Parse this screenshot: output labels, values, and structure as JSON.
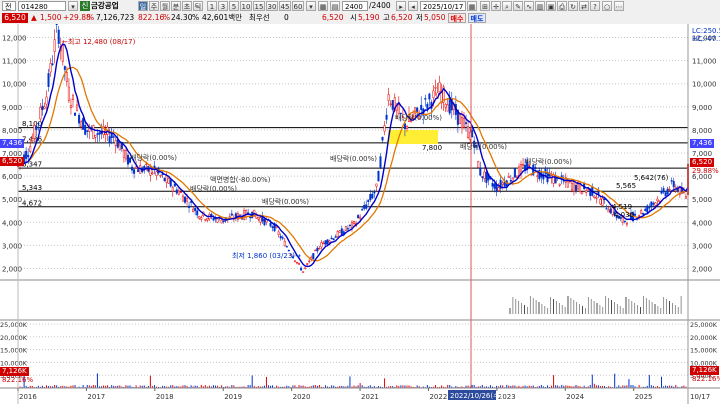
{
  "toolbar": {
    "code_prefix": "전",
    "code": "014280",
    "name": "금강공업",
    "period_buttons": [
      "주",
      "월",
      "분",
      "초",
      "틱"
    ],
    "interval_buttons": [
      "1",
      "3",
      "5",
      "10",
      "15",
      "30",
      "45",
      "60"
    ],
    "count": "2400",
    "count_total": "/2400",
    "date": "2025/10/17",
    "buy_label": "매수",
    "sell_label": "매도",
    "price_change_badge": "6,520",
    "change": "1,500",
    "change_pct": "+29.88",
    "volume": "7,126,723",
    "turnover_pct": "822.16",
    "ratio": "24.30",
    "amount": "42,601백만",
    "min_label": "최우선",
    "min_value": "0",
    "close": "6,520",
    "open_label": "시",
    "open": "5,190",
    "high_label": "고",
    "high": "6,520",
    "low_label": "저",
    "low": "5,050"
  },
  "price_axis": [
    "12,000",
    "11,000",
    "10,000",
    "9,000",
    "8,000",
    "7,000",
    "6,000",
    "5,000",
    "4,000",
    "3,000",
    "2,000"
  ],
  "volume_axis": [
    "25,000K",
    "20,000K",
    "15,000K",
    "10,000K",
    "5,000K"
  ],
  "year_labels": [
    "2016",
    "2017",
    "2018",
    "2019",
    "2020",
    "2021",
    "2022",
    "2023",
    "2024",
    "2025"
  ],
  "right_end_label": "10/17",
  "cursor_date": "2022/10/26(수)",
  "right_info": {
    "lc": "LC:250.54",
    "hc": "HC:-47.76"
  },
  "price_tags": {
    "left_red": "6,520",
    "left_top": "7,436",
    "right_top": "7,436",
    "right_red": "6,520",
    "right_pct": "29.88%",
    "right_vol_k": "7,126K",
    "right_vol_pct": "822.16%",
    "left_vol_k": "7,126K",
    "left_vol_pct": "822.16%"
  },
  "level_labels": [
    "8,100",
    "7,436",
    "6,347",
    "5,343",
    "4,672"
  ],
  "annotations": {
    "high": "최고 12,480 (08/17)",
    "low": "최저 1,860 (03/23)",
    "div1": "배당락(0.00%)",
    "div2": "배당락(0.00%)",
    "div3": "배당락(0.00%)",
    "div4": "배당락(0.00%)",
    "div5": "배당락(0.00%)",
    "div6": "배당락(0.00%)",
    "div7": "배당락(0.00%)",
    "reverse_split": "액면병합(-80.00%)",
    "p5642": "5,642(76)",
    "p7800": "7,800",
    "p5565": "5,565",
    "p4519": "4,519",
    "p4030": "4,030"
  },
  "colors": {
    "up": "#e60000",
    "down": "#0033cc",
    "ma_short": "#0000c8",
    "ma_long": "#e07800",
    "ma_mid": "#d00000",
    "grid": "#c8c8c8"
  },
  "chart_data": {
    "type": "candlestick",
    "x_range": [
      "2016-01",
      "2025-10-17"
    ],
    "ylim": [
      1500,
      12500
    ],
    "price_path": [
      [
        "2016-01",
        6400
      ],
      [
        "2016-03",
        7200
      ],
      [
        "2016-06",
        9500
      ],
      [
        "2016-08",
        12480
      ],
      [
        "2016-10",
        9500
      ],
      [
        "2017-01",
        8000
      ],
      [
        "2017-06",
        7700
      ],
      [
        "2017-09",
        6400
      ],
      [
        "2018-01",
        6200
      ],
      [
        "2018-05",
        5400
      ],
      [
        "2018-09",
        4300
      ],
      [
        "2019-01",
        4100
      ],
      [
        "2019-06",
        4400
      ],
      [
        "2019-10",
        3800
      ],
      [
        "2020-03",
        1860
      ],
      [
        "2020-06",
        3000
      ],
      [
        "2020-12",
        3900
      ],
      [
        "2021-04",
        5500
      ],
      [
        "2021-06",
        9500
      ],
      [
        "2021-09",
        8200
      ],
      [
        "2022-03",
        9700
      ],
      [
        "2022-09",
        7600
      ],
      [
        "2022-10",
        6200
      ],
      [
        "2023-01",
        5500
      ],
      [
        "2023-06",
        6400
      ],
      [
        "2023-12",
        5800
      ],
      [
        "2024-06",
        5300
      ],
      [
        "2024-11",
        4030
      ],
      [
        "2025-03",
        4500
      ],
      [
        "2025-08",
        5642
      ],
      [
        "2025-10-16",
        5020
      ],
      [
        "2025-10-17",
        6520
      ]
    ],
    "horizontal_levels": [
      8100,
      7436,
      6347,
      5343,
      4672
    ],
    "volume_unit": "K",
    "volume_ylim": [
      0,
      25000
    ],
    "volume_last": 7126
  }
}
